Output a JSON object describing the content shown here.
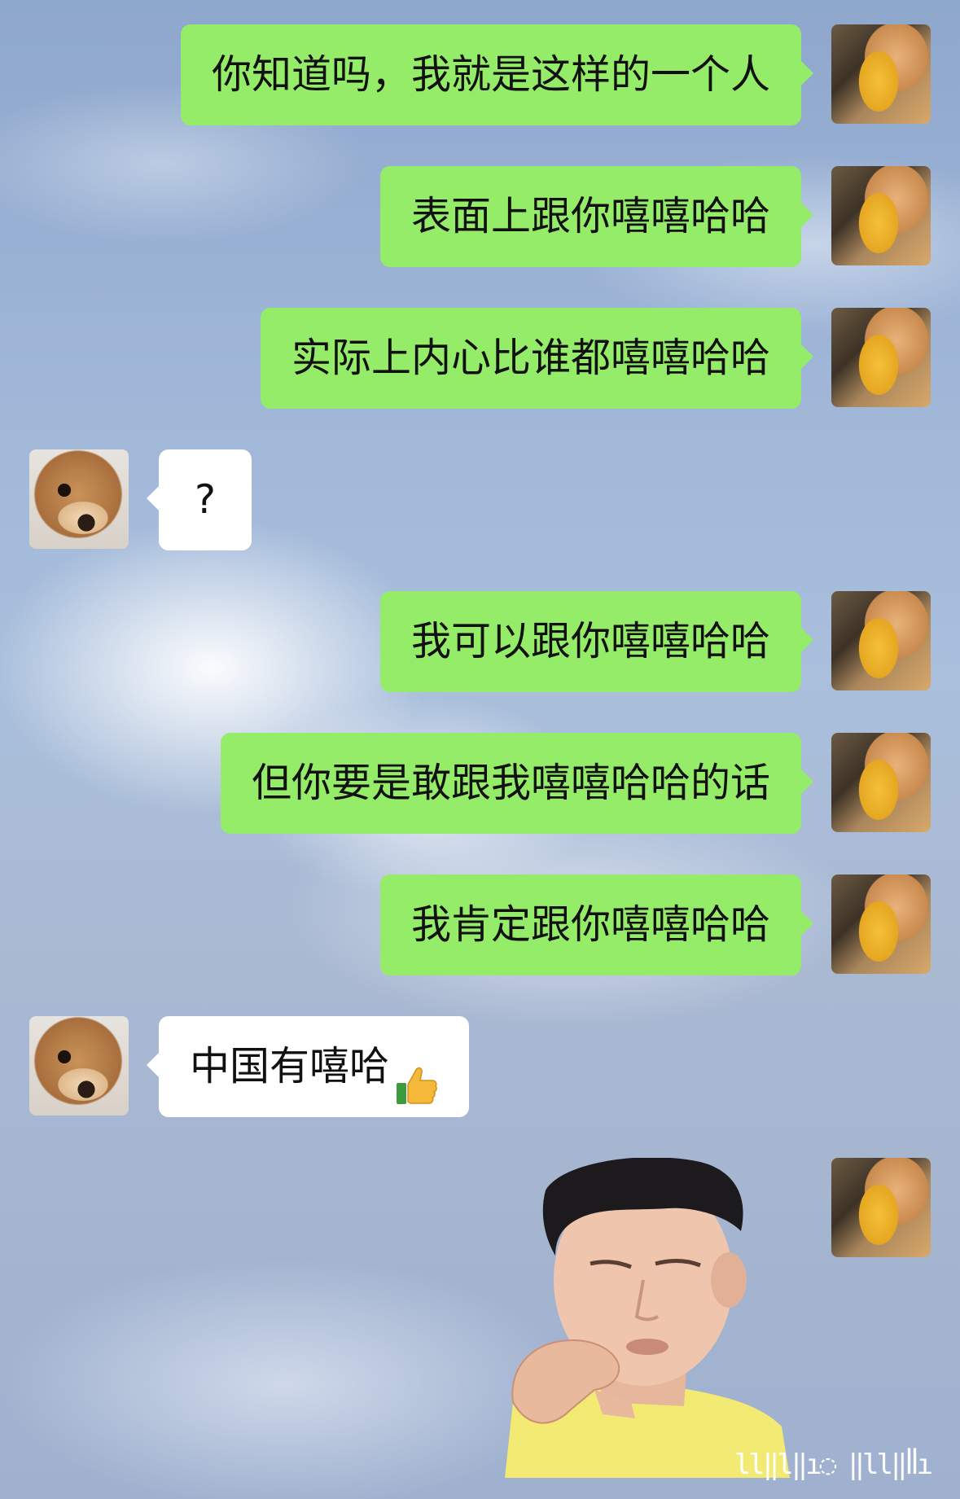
{
  "messages": [
    {
      "side": "right",
      "text": "你知道吗，我就是这样的一个人"
    },
    {
      "side": "right",
      "text": "表面上跟你嘻嘻哈哈"
    },
    {
      "side": "right",
      "text": "实际上内心比谁都嘻嘻哈哈"
    },
    {
      "side": "left",
      "text": "?"
    },
    {
      "side": "right",
      "text": "我可以跟你嘻嘻哈哈"
    },
    {
      "side": "right",
      "text": "但你要是敢跟我嘻嘻哈哈的话"
    },
    {
      "side": "right",
      "text": "我肯定跟你嘻嘻哈哈"
    },
    {
      "side": "left",
      "text": "中国有嘻哈",
      "emoji": "thumbs-up"
    },
    {
      "side": "right",
      "type": "sticker",
      "sticker": "man-face-sticker"
    }
  ],
  "avatars": {
    "me": "cat-with-bread-avatar",
    "other": "dog-face-avatar"
  },
  "colors": {
    "sent_bubble": "#95ec69",
    "received_bubble": "#ffffff"
  },
  "watermark": "ll‖l‖ı◌ ‖ll‖ꟾꟾı"
}
